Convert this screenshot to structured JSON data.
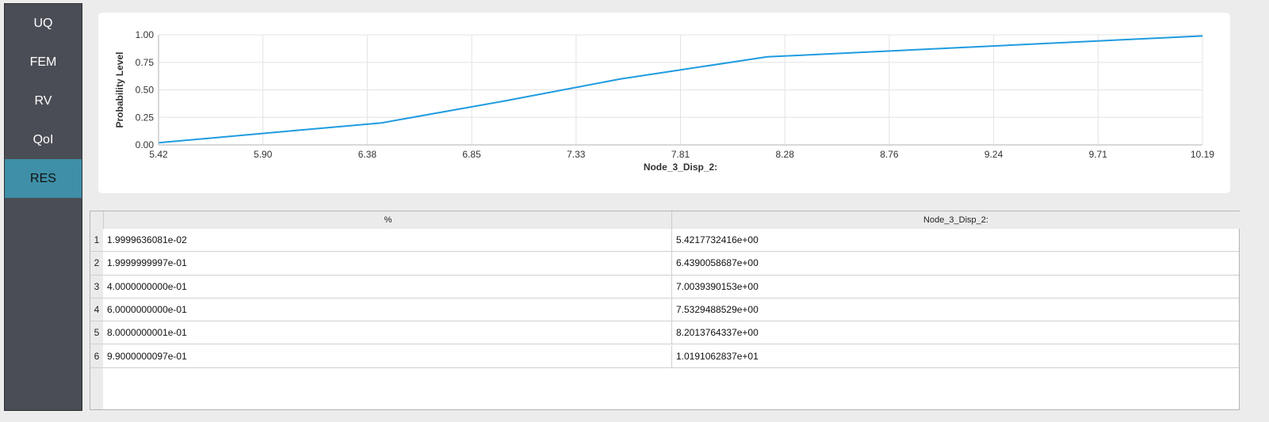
{
  "sidebar": {
    "items": [
      {
        "label": "UQ"
      },
      {
        "label": "FEM"
      },
      {
        "label": "RV"
      },
      {
        "label": "QoI"
      },
      {
        "label": "RES"
      }
    ],
    "active": "RES"
  },
  "chart_data": {
    "type": "line",
    "title": "",
    "xlabel": "Node_3_Disp_2:",
    "ylabel": "Probability Level",
    "xlim": [
      5.42,
      10.19
    ],
    "ylim": [
      0,
      1
    ],
    "xticks": [
      "5.42",
      "5.90",
      "6.38",
      "6.85",
      "7.33",
      "7.81",
      "8.28",
      "8.76",
      "9.24",
      "9.71",
      "10.19"
    ],
    "yticks": [
      "0.00",
      "0.25",
      "0.50",
      "0.75",
      "1.00"
    ],
    "grid": true,
    "color": "#1f9be0",
    "x": [
      5.4217732416,
      6.4390058687,
      7.0039390153,
      7.5329488529,
      8.2013764337,
      10.191062837
    ],
    "y": [
      0.019999636081,
      0.19999999997,
      0.4,
      0.6,
      0.80000000001,
      0.99000000097
    ]
  },
  "table": {
    "headers": [
      "%",
      "Node_3_Disp_2:"
    ],
    "rows": [
      [
        "1.9999636081e-02",
        "5.4217732416e+00"
      ],
      [
        "1.9999999997e-01",
        "6.4390058687e+00"
      ],
      [
        "4.0000000000e-01",
        "7.0039390153e+00"
      ],
      [
        "6.0000000000e-01",
        "7.5329488529e+00"
      ],
      [
        "8.0000000001e-01",
        "8.2013764337e+00"
      ],
      [
        "9.9000000097e-01",
        "1.0191062837e+01"
      ]
    ]
  }
}
